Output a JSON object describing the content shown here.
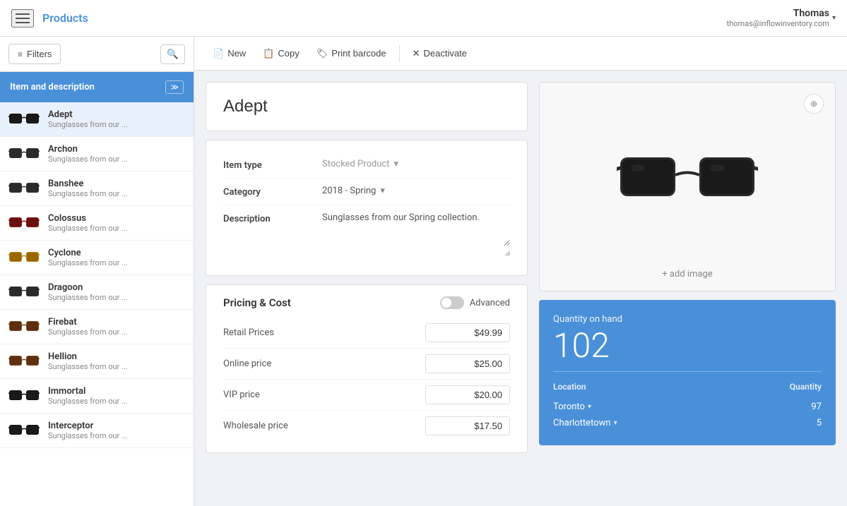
{
  "app": {
    "title": "Products"
  },
  "user": {
    "name": "Thomas",
    "email": "thomas@inflowinventory.com"
  },
  "toolbar": {
    "new_label": "New",
    "copy_label": "Copy",
    "print_label": "Print barcode",
    "deactivate_label": "Deactivate"
  },
  "sidebar": {
    "header": "Item and description",
    "filters_label": "Filters",
    "items": [
      {
        "name": "Adept",
        "desc": "Sunglasses from our ...",
        "color": "black",
        "active": true
      },
      {
        "name": "Archon",
        "desc": "Sunglasses from our ...",
        "color": "dark"
      },
      {
        "name": "Banshee",
        "desc": "Sunglasses from our ...",
        "color": "dark"
      },
      {
        "name": "Colossus",
        "desc": "Sunglasses from our ...",
        "color": "red"
      },
      {
        "name": "Cyclone",
        "desc": "Sunglasses from our ...",
        "color": "gold"
      },
      {
        "name": "Dragoon",
        "desc": "Sunglasses from our ...",
        "color": "dark"
      },
      {
        "name": "Firebat",
        "desc": "Sunglasses from our ...",
        "color": "brown"
      },
      {
        "name": "Hellion",
        "desc": "Sunglasses from our ...",
        "color": "brown"
      },
      {
        "name": "Immortal",
        "desc": "Sunglasses from our ...",
        "color": "black"
      },
      {
        "name": "Interceptor",
        "desc": "Sunglasses from our ...",
        "color": "black"
      }
    ]
  },
  "product": {
    "title": "Adept",
    "item_type_label": "Item type",
    "item_type_value": "Stocked Product",
    "category_label": "Category",
    "category_value": "2018 - Spring",
    "description_label": "Description",
    "description_value": "Sunglasses from our Spring collection.",
    "add_image_label": "+ add image",
    "pricing": {
      "title": "Pricing & Cost",
      "advanced_label": "Advanced",
      "retail_label": "Retail Prices",
      "retail_value": "$49.99",
      "online_label": "Online price",
      "online_value": "$25.00",
      "vip_label": "VIP price",
      "vip_value": "$20.00",
      "wholesale_label": "Wholesale price",
      "wholesale_value": "$17.50"
    },
    "quantity": {
      "label": "Quantity on hand",
      "total": "102",
      "location_header": "Location",
      "quantity_header": "Quantity",
      "rows": [
        {
          "location": "Toronto",
          "quantity": "97"
        },
        {
          "location": "Charlottetown",
          "quantity": "5"
        }
      ]
    }
  }
}
